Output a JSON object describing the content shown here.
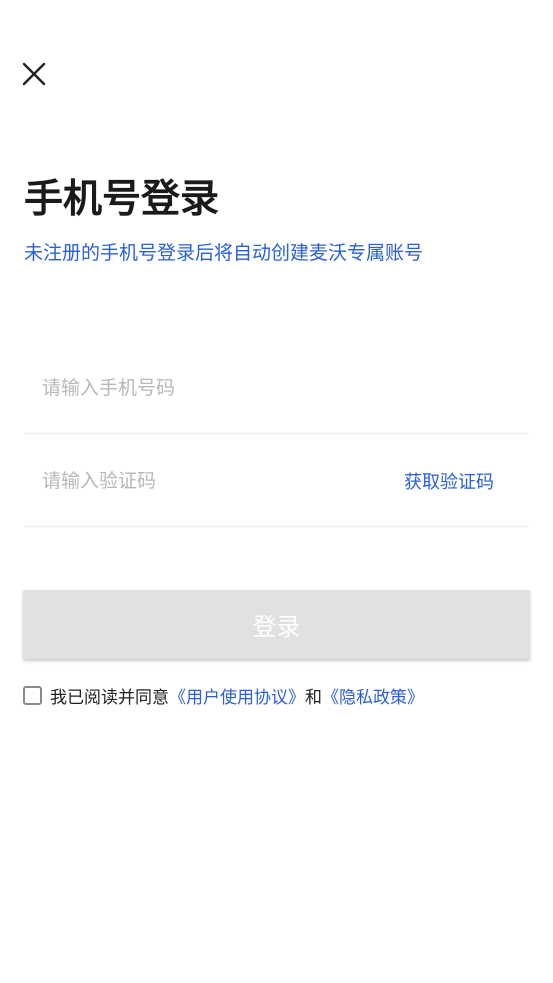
{
  "header": {
    "close_icon": "close-icon"
  },
  "title": "手机号登录",
  "subtitle": "未注册的手机号登录后将自动创建麦沃专属账号",
  "form": {
    "phone_placeholder": "请输入手机号码",
    "code_placeholder": "请输入验证码",
    "get_code_label": "获取验证码",
    "login_label": "登录"
  },
  "agreement": {
    "checked": false,
    "prefix": "我已阅读并同意",
    "user_agreement": "《用户使用协议》",
    "conjunction": "和",
    "privacy_policy": "《隐私政策》"
  },
  "colors": {
    "accent": "#2a5fd6",
    "title": "#1a1a1a",
    "button_disabled": "#e1e1e1",
    "placeholder": "#b8b8b8"
  }
}
